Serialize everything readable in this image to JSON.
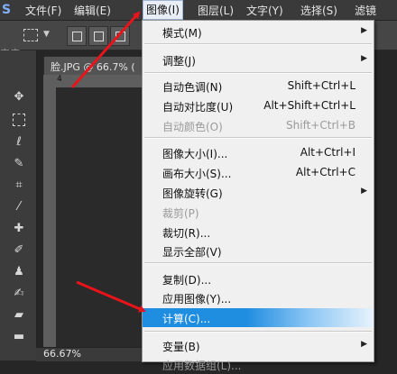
{
  "app": {
    "logo_glyph": "S"
  },
  "menubar": {
    "items": [
      "文件(F)",
      "编辑(E)",
      "图像(I)",
      "图层(L)",
      "文字(Y)",
      "选择(S)",
      "滤镜"
    ],
    "active_index": 2
  },
  "options_bar": {
    "left_cut_text": "交应"
  },
  "document": {
    "tab_label": "脸.JPG @ 66.7% (",
    "zoom": "66.67%",
    "ruler_origin": "4"
  },
  "image_menu": {
    "items": [
      {
        "label": "模式(M)",
        "shortcut": "",
        "submenu": true,
        "enabled": true
      },
      {
        "label": "调整(J)",
        "shortcut": "",
        "submenu": true,
        "enabled": true
      },
      {
        "label": "自动色调(N)",
        "shortcut": "Shift+Ctrl+L",
        "submenu": false,
        "enabled": true
      },
      {
        "label": "自动对比度(U)",
        "shortcut": "Alt+Shift+Ctrl+L",
        "submenu": false,
        "enabled": true
      },
      {
        "label": "自动颜色(O)",
        "shortcut": "Shift+Ctrl+B",
        "submenu": false,
        "enabled": false
      },
      {
        "label": "图像大小(I)...",
        "shortcut": "Alt+Ctrl+I",
        "submenu": false,
        "enabled": true
      },
      {
        "label": "画布大小(S)...",
        "shortcut": "Alt+Ctrl+C",
        "submenu": false,
        "enabled": true
      },
      {
        "label": "图像旋转(G)",
        "shortcut": "",
        "submenu": true,
        "enabled": true
      },
      {
        "label": "裁剪(P)",
        "shortcut": "",
        "submenu": false,
        "enabled": false
      },
      {
        "label": "裁切(R)...",
        "shortcut": "",
        "submenu": false,
        "enabled": true
      },
      {
        "label": "显示全部(V)",
        "shortcut": "",
        "submenu": false,
        "enabled": true
      },
      {
        "label": "复制(D)...",
        "shortcut": "",
        "submenu": false,
        "enabled": true
      },
      {
        "label": "应用图像(Y)...",
        "shortcut": "",
        "submenu": false,
        "enabled": true
      },
      {
        "label": "计算(C)...",
        "shortcut": "",
        "submenu": false,
        "enabled": true,
        "highlighted": true
      },
      {
        "label": "变量(B)",
        "shortcut": "",
        "submenu": true,
        "enabled": true
      },
      {
        "label": "应用数据组(L)...",
        "shortcut": "",
        "submenu": false,
        "enabled": false
      }
    ]
  },
  "colors": {
    "accent_highlight": "#1f8de0",
    "annotation_arrow": "#e8141a"
  },
  "icons": {
    "submenu_arrow": "▶",
    "dropdown_arrow": "▼"
  }
}
